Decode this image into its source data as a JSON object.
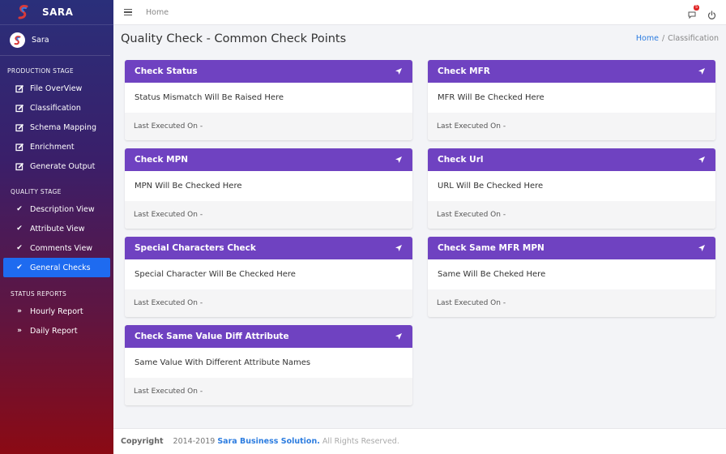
{
  "brand": {
    "name": "SARA"
  },
  "user": {
    "name": "Sara"
  },
  "sidebar": {
    "sections": [
      {
        "title": "PRODUCTION STAGE",
        "items": [
          {
            "label": "File OverView",
            "icon": "edit-icon"
          },
          {
            "label": "Classification",
            "icon": "edit-icon"
          },
          {
            "label": "Schema Mapping",
            "icon": "edit-icon"
          },
          {
            "label": "Enrichment",
            "icon": "edit-icon"
          },
          {
            "label": "Generate Output",
            "icon": "edit-icon"
          }
        ]
      },
      {
        "title": "QUALITY STAGE",
        "items": [
          {
            "label": "Description View",
            "icon": "check-double-icon"
          },
          {
            "label": "Attribute View",
            "icon": "check-double-icon"
          },
          {
            "label": "Comments View",
            "icon": "check-double-icon"
          },
          {
            "label": "General Checks",
            "icon": "check-double-icon",
            "active": true
          }
        ]
      },
      {
        "title": "STATUS REPORTS",
        "items": [
          {
            "label": "Hourly Report",
            "icon": "angle-double-right-icon"
          },
          {
            "label": "Daily Report",
            "icon": "angle-double-right-icon"
          }
        ]
      }
    ]
  },
  "topbar": {
    "home_label": "Home",
    "notification_count": "5"
  },
  "page": {
    "title": "Quality Check - Common Check Points",
    "breadcrumb": {
      "home": "Home",
      "separator": "/",
      "current": "Classification"
    }
  },
  "cards": [
    {
      "title": "Check Status",
      "body": "Status Mismatch Will Be Raised Here",
      "footer": "Last Executed On -"
    },
    {
      "title": "Check MFR",
      "body": "MFR Will Be Checked Here",
      "footer": "Last Executed On -"
    },
    {
      "title": "Check MPN",
      "body": "MPN Will Be Checked Here",
      "footer": "Last Executed On -"
    },
    {
      "title": "Check Url",
      "body": "URL Will Be Checked Here",
      "footer": "Last Executed On -"
    },
    {
      "title": "Special Characters Check",
      "body": "Special Character Will Be Checked Here",
      "footer": "Last Executed On -"
    },
    {
      "title": "Check Same MFR MPN",
      "body": "Same Will Be Cheked Here",
      "footer": "Last Executed On -"
    },
    {
      "title": "Check Same Value Diff Attribute",
      "body": "Same Value With Different Attribute Names",
      "footer": "Last Executed On -"
    }
  ],
  "footer": {
    "copyright": "Copyright",
    "years": "2014-2019",
    "company": "Sara Business Solution.",
    "rights": "All Rights Reserved."
  },
  "colors": {
    "card_header": "#6f42c1",
    "active_nav": "#1e6bf0",
    "link": "#2d7de0"
  }
}
